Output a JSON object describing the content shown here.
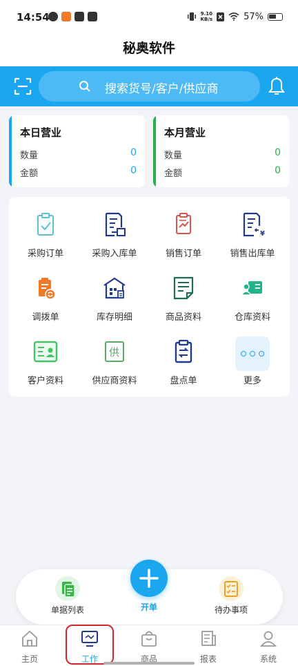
{
  "status_bar": {
    "time": "14:54",
    "net_speed_value": "9.10",
    "net_speed_unit": "KB/s",
    "battery": "57%"
  },
  "header": {
    "title": "秘奥软件"
  },
  "search": {
    "placeholder": "搜索货号/客户/供应商"
  },
  "summary": {
    "today": {
      "title": "本日营业",
      "qty_label": "数量",
      "qty_value": "0",
      "amount_label": "金额",
      "amount_value": "0"
    },
    "month": {
      "title": "本月营业",
      "qty_label": "数量",
      "qty_value": "0",
      "amount_label": "金额",
      "amount_value": "0"
    }
  },
  "functions": [
    {
      "label": "采购订单",
      "icon": "clipboard-check-icon"
    },
    {
      "label": "采购入库单",
      "icon": "doc-inbound-icon"
    },
    {
      "label": "销售订单",
      "icon": "sales-order-icon"
    },
    {
      "label": "销售出库单",
      "icon": "doc-outbound-icon"
    },
    {
      "label": "调拨单",
      "icon": "transfer-icon"
    },
    {
      "label": "库存明细",
      "icon": "warehouse-building-icon"
    },
    {
      "label": "商品资料",
      "icon": "product-doc-icon"
    },
    {
      "label": "仓库资料",
      "icon": "warehouse-card-icon"
    },
    {
      "label": "客户资料",
      "icon": "customer-card-icon"
    },
    {
      "label": "供应商资料",
      "icon": "supplier-icon"
    },
    {
      "label": "盘点单",
      "icon": "inventory-count-icon"
    },
    {
      "label": "更多",
      "icon": "more-icon"
    }
  ],
  "supplier_glyph": "供",
  "actions": {
    "bill_list": "单据列表",
    "new_bill": "开单",
    "todo": "待办事项"
  },
  "bottom_nav": [
    {
      "label": "主页",
      "icon": "home-icon"
    },
    {
      "label": "工作",
      "icon": "monitor-icon"
    },
    {
      "label": "商品",
      "icon": "bag-icon"
    },
    {
      "label": "报表",
      "icon": "report-icon"
    },
    {
      "label": "系统",
      "icon": "user-icon"
    }
  ],
  "colors": {
    "primary": "#1ba7f0",
    "today_stripe": "#1ba7f0",
    "month_stripe": "#22b14c",
    "highlight": "#d9232d"
  }
}
